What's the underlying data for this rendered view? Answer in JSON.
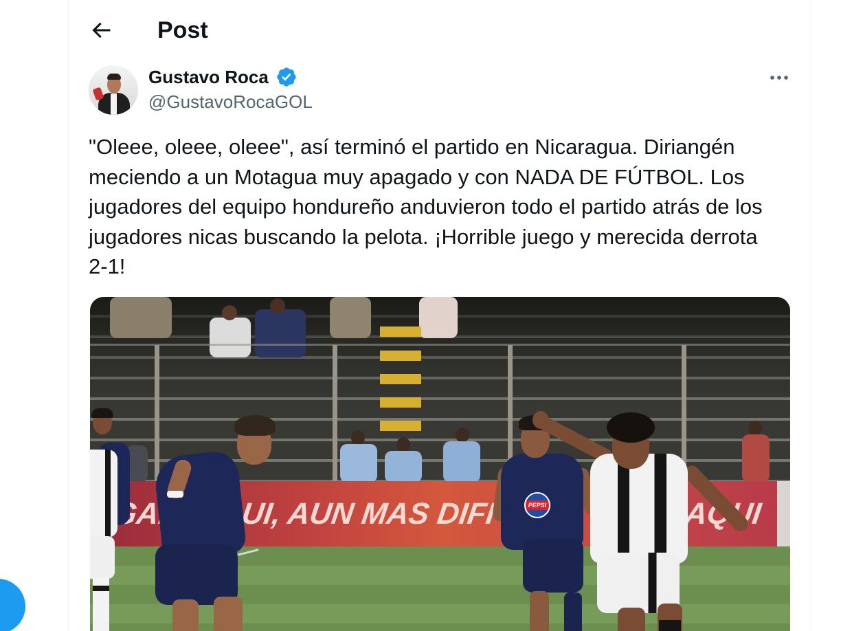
{
  "header": {
    "title": "Post",
    "back_icon": "arrow-left-icon"
  },
  "author": {
    "name": "Gustavo Roca",
    "handle": "@GustavoRocaGOL",
    "verified": true,
    "verified_icon": "verified-badge-icon"
  },
  "post_menu": {
    "icon": "more-horizontal-icon"
  },
  "tweet": {
    "text_lines": [
      "\"Oleee, oleee, oleee\", así terminó el partido en Nicaragua. Diriangén",
      "meciendo a un Motagua muy apagado y con NADA DE FÚTBOL. Los",
      "jugadores del equipo hondureño anduvieron todo el partido atrás de los",
      "jugadores nicas buscando la pelota. ¡Horrible juego y merecida derrota",
      "2-1!"
    ]
  },
  "photo": {
    "banner_segments": [
      "GAR",
      "QUI, AUN MAS DIFI",
      "R AQUI"
    ],
    "jersey_sponsor": "PEPSI"
  },
  "colors": {
    "accent": "#1d9bf0",
    "text": "#0f1419",
    "secondary_text": "#536471",
    "border": "#eff3f4"
  }
}
